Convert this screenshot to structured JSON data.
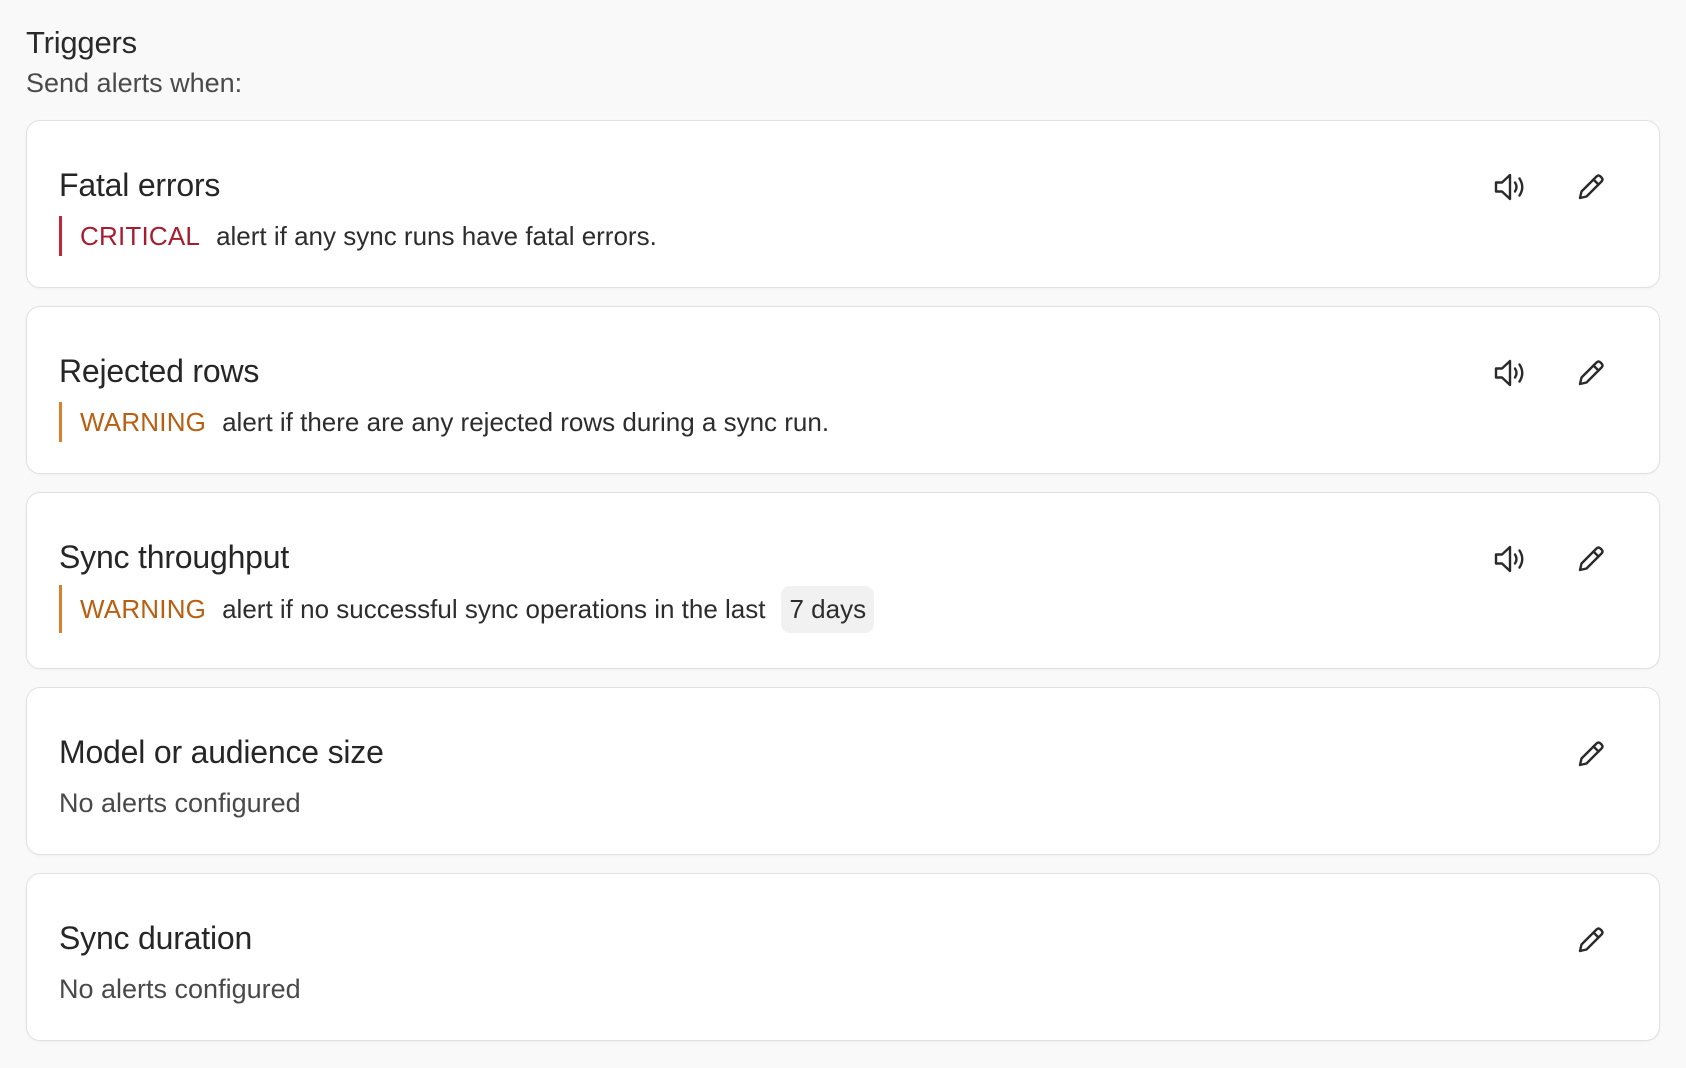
{
  "section": {
    "title": "Triggers",
    "subtitle": "Send alerts when:"
  },
  "colors": {
    "critical": "#a51d2f",
    "warning": "#b85f12",
    "card_bg": "#ffffff",
    "page_bg": "#f9f9f9"
  },
  "cards": [
    {
      "title": "Fatal errors",
      "severity": "CRITICAL",
      "text": "alert if any sync runs have fatal errors.",
      "icons": [
        "volume-icon",
        "edit-pencil-icon"
      ]
    },
    {
      "title": "Rejected rows",
      "severity": "WARNING",
      "text": "alert if there are any rejected rows during a sync run.",
      "icons": [
        "volume-icon",
        "edit-pencil-icon"
      ]
    },
    {
      "title": "Sync throughput",
      "severity": "WARNING",
      "text": "alert if no successful sync operations in the last",
      "duration": "7 days",
      "icons": [
        "volume-icon",
        "edit-pencil-icon"
      ]
    },
    {
      "title": "Model or audience size",
      "status": "No alerts configured",
      "icons": [
        "edit-pencil-icon"
      ]
    },
    {
      "title": "Sync duration",
      "status": "No alerts configured",
      "icons": [
        "edit-pencil-icon"
      ]
    }
  ]
}
